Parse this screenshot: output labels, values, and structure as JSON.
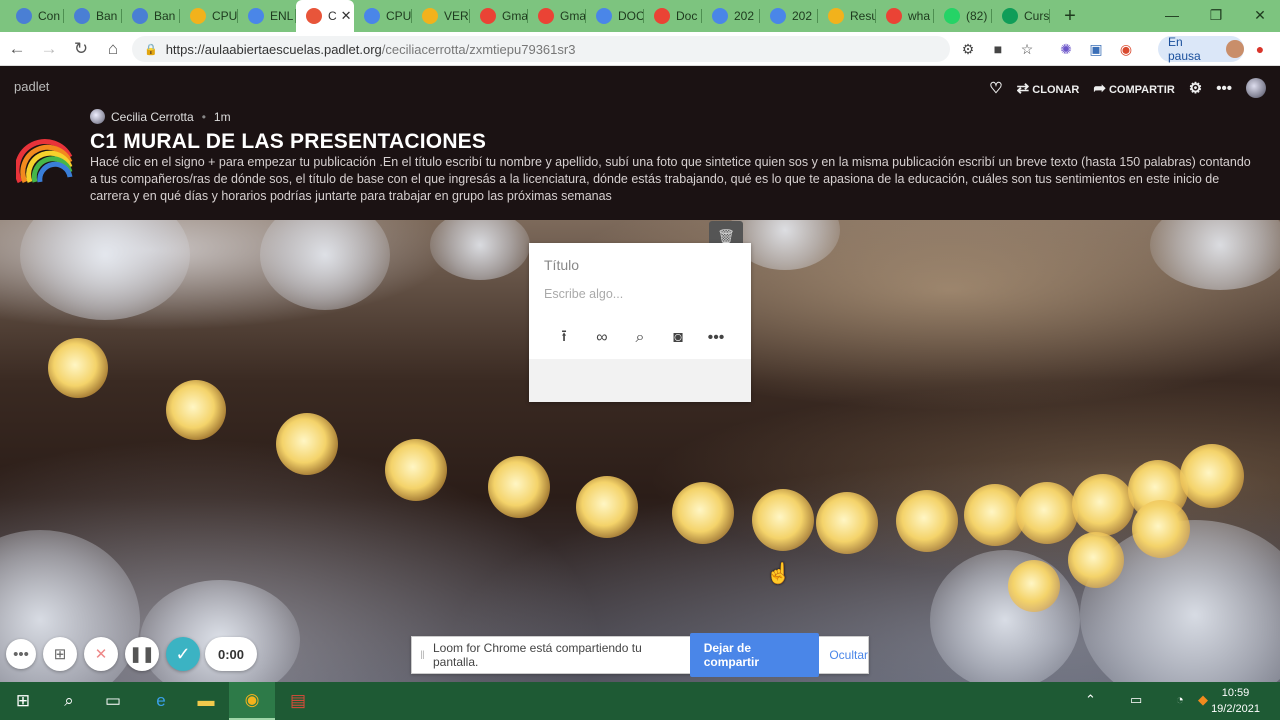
{
  "browser": {
    "tabs": [
      {
        "label": "Con",
        "icon": "c-circle-icon",
        "color": "#4a7fd4"
      },
      {
        "label": "Ban",
        "icon": "c-circle-icon",
        "color": "#4a7fd4"
      },
      {
        "label": "Ban",
        "icon": "c-circle-icon",
        "color": "#4a7fd4"
      },
      {
        "label": "CPU",
        "icon": "drive-icon",
        "color": "#f2b21c"
      },
      {
        "label": "ENL",
        "icon": "docs-icon",
        "color": "#4a86e8"
      },
      {
        "label": "C",
        "icon": "rainbow-icon",
        "color": "#e8553a"
      },
      {
        "label": "CPU",
        "icon": "docs-icon",
        "color": "#4a86e8"
      },
      {
        "label": "VER",
        "icon": "drive-icon",
        "color": "#f2b21c"
      },
      {
        "label": "Gma",
        "icon": "google-icon",
        "color": "#ea4335"
      },
      {
        "label": "Gma",
        "icon": "google-icon",
        "color": "#ea4335"
      },
      {
        "label": "DOC",
        "icon": "docs-icon",
        "color": "#4a86e8"
      },
      {
        "label": "Doc",
        "icon": "google-icon",
        "color": "#ea4335"
      },
      {
        "label": "202",
        "icon": "docs-icon",
        "color": "#4a86e8"
      },
      {
        "label": "202",
        "icon": "docs-icon",
        "color": "#4a86e8"
      },
      {
        "label": "Resu",
        "icon": "drive-icon",
        "color": "#f2b21c"
      },
      {
        "label": "wha",
        "icon": "google-icon",
        "color": "#ea4335"
      },
      {
        "label": "(82)",
        "icon": "whatsapp-icon",
        "color": "#25d366"
      },
      {
        "label": "Curs",
        "icon": "classroom-icon",
        "color": "#0f9d58"
      }
    ],
    "url": {
      "host": "https://aulaabiertaescuelas.padlet.org",
      "path": "/ceciliacerrotta/zxmtiepu79361sr3"
    },
    "profile_status": "En pausa"
  },
  "padlet": {
    "brand": "padlet",
    "actions": {
      "clone": "CLONAR",
      "share": "COMPARTIR"
    },
    "author": "Cecilia Cerrotta",
    "time_ago": "1m",
    "title": "C1 MURAL DE LAS PRESENTACIONES",
    "description": "Hacé clic en el signo + para empezar tu publicación .En el título escribí tu nombre y apellido, subí una foto que sintetice quien sos y en la misma publicación escribí un breve texto (hasta 150 palabras) contando a tus compañeros/ras de dónde sos, el título de base con el que ingresás a la licenciatura, dónde estás trabajando, qué es lo que te apasiona de la educación, cuáles son tus sentimientos en este inicio de carrera y en qué días y horarios podrías juntarte para trabajar en grupo las próximas semanas"
  },
  "post": {
    "title_placeholder": "Título",
    "body_placeholder": "Escribe algo..."
  },
  "loom": {
    "timer": "0:00",
    "share_message": "Loom for Chrome está compartiendo tu pantalla.",
    "stop_label": "Dejar de compartir",
    "hide_label": "Ocultar"
  },
  "taskbar": {
    "time": "10:59",
    "date": "19/2/2021"
  }
}
